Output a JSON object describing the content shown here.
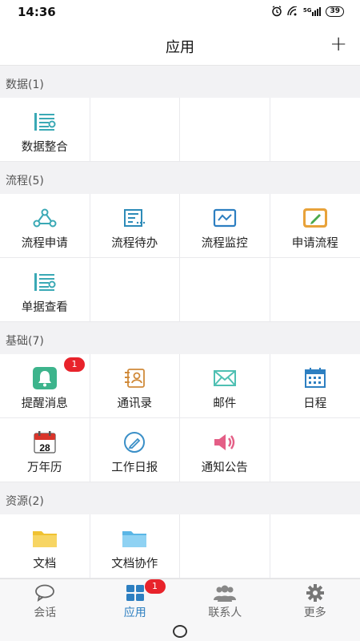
{
  "status": {
    "time": "14:36",
    "battery": "39",
    "signal_label": "5G"
  },
  "header": {
    "title": "应用",
    "add_icon": "plus-icon"
  },
  "sections": [
    {
      "title": "数据(1)",
      "items": [
        {
          "label": "数据整合",
          "icon": "list-icon"
        }
      ]
    },
    {
      "title": "流程(5)",
      "items": [
        {
          "label": "流程申请",
          "icon": "flow-nodes-icon"
        },
        {
          "label": "流程待办",
          "icon": "todo-doc-icon"
        },
        {
          "label": "流程监控",
          "icon": "monitor-icon"
        },
        {
          "label": "申请流程",
          "icon": "edit-note-icon"
        },
        {
          "label": "单据查看",
          "icon": "list-icon"
        }
      ]
    },
    {
      "title": "基础(7)",
      "items": [
        {
          "label": "提醒消息",
          "icon": "bell-icon",
          "badge": "1"
        },
        {
          "label": "通讯录",
          "icon": "contacts-icon"
        },
        {
          "label": "邮件",
          "icon": "mail-icon"
        },
        {
          "label": "日程",
          "icon": "calendar-icon"
        },
        {
          "label": "万年历",
          "icon": "day-calendar-icon",
          "day": "28"
        },
        {
          "label": "工作日报",
          "icon": "pencil-circle-icon"
        },
        {
          "label": "通知公告",
          "icon": "speaker-icon"
        }
      ]
    },
    {
      "title": "资源(2)",
      "items": [
        {
          "label": "文档",
          "icon": "folder-yellow-icon"
        },
        {
          "label": "文档协作",
          "icon": "folder-blue-icon"
        }
      ]
    }
  ],
  "tabs": [
    {
      "label": "会话",
      "icon": "chat-icon",
      "active": false
    },
    {
      "label": "应用",
      "icon": "apps-icon",
      "active": true,
      "badge": "1"
    },
    {
      "label": "联系人",
      "icon": "people-icon",
      "active": false
    },
    {
      "label": "更多",
      "icon": "gear-icon",
      "active": false
    }
  ],
  "colors": {
    "accent": "#2d7fc1",
    "teal": "#3aa9b5",
    "badge": "#e8232b",
    "background": "#f2f2f4"
  }
}
